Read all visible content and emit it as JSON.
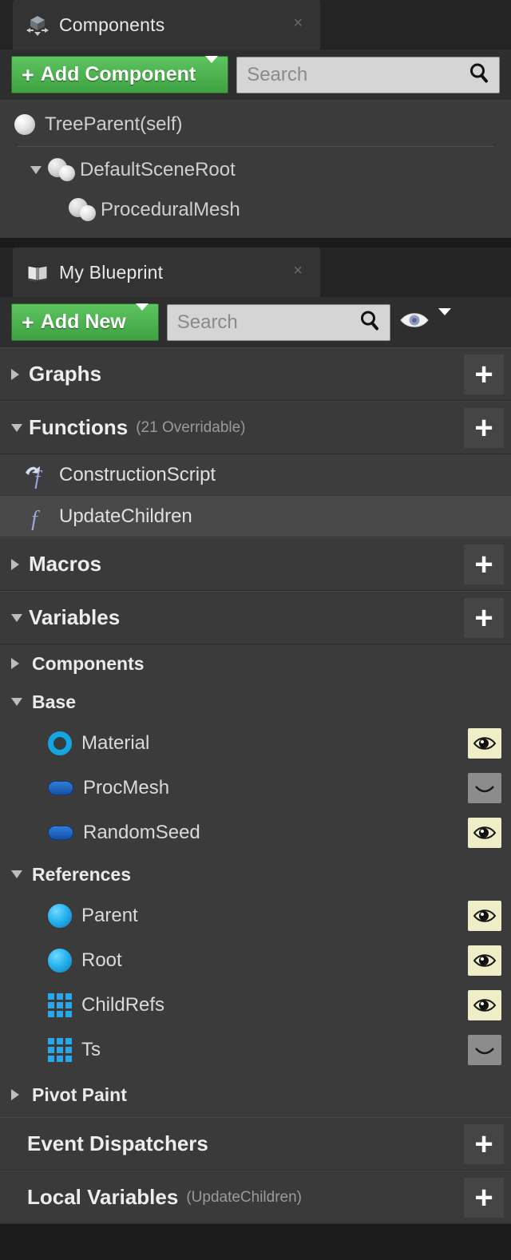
{
  "components_panel": {
    "tab": {
      "label": "Components",
      "icon": "components-cube-icon",
      "close": "×"
    },
    "toolbar": {
      "add_label": "Add Component",
      "add_plus": "+",
      "search_placeholder": "Search"
    },
    "tree": [
      {
        "label": "TreeParent(self)",
        "icon": "sphere-icon",
        "indent": 0,
        "expander": "none"
      },
      {
        "label": "DefaultSceneRoot",
        "icon": "scene-root-icon",
        "indent": 1,
        "expander": "expanded"
      },
      {
        "label": "ProceduralMesh",
        "icon": "mesh-icon",
        "indent": 2,
        "expander": "none"
      }
    ]
  },
  "my_blueprint_panel": {
    "tab": {
      "label": "My Blueprint",
      "icon": "book-icon",
      "close": "×"
    },
    "toolbar": {
      "add_label": "Add New",
      "add_plus": "+",
      "search_placeholder": "Search",
      "eye_icon": "eye-icon",
      "eye_caret": "chevron-down-icon"
    },
    "sections": {
      "graphs": {
        "title": "Graphs",
        "expander": "collapsed",
        "add": "+"
      },
      "functions": {
        "title": "Functions",
        "subtitle": "(21 Overridable)",
        "expander": "expanded",
        "add": "+"
      },
      "macros": {
        "title": "Macros",
        "expander": "collapsed",
        "add": "+"
      },
      "variables": {
        "title": "Variables",
        "expander": "expanded",
        "add": "+"
      },
      "event_dispatchers": {
        "title": "Event Dispatchers",
        "add": "+"
      },
      "local_variables": {
        "title": "Local Variables",
        "subtitle": "(UpdateChildren)",
        "add": "+"
      }
    },
    "functions": [
      {
        "label": "ConstructionScript",
        "icon": "function-override-icon",
        "selected": false
      },
      {
        "label": "UpdateChildren",
        "icon": "function-icon",
        "selected": true
      }
    ],
    "variable_categories": [
      {
        "label": "Components",
        "expander": "collapsed",
        "items": []
      },
      {
        "label": "Base",
        "expander": "expanded",
        "items": [
          {
            "label": "Material",
            "icon": "object-ring-icon",
            "visibility": "visible"
          },
          {
            "label": "ProcMesh",
            "icon": "object-pill-icon",
            "visibility": "hidden"
          },
          {
            "label": "RandomSeed",
            "icon": "object-pill-icon",
            "visibility": "visible"
          }
        ]
      },
      {
        "label": "References",
        "expander": "expanded",
        "items": [
          {
            "label": "Parent",
            "icon": "object-sphere-icon",
            "visibility": "visible"
          },
          {
            "label": "Root",
            "icon": "object-sphere-icon",
            "visibility": "visible"
          },
          {
            "label": "ChildRefs",
            "icon": "array-icon",
            "visibility": "visible"
          },
          {
            "label": "Ts",
            "icon": "array-icon",
            "visibility": "hidden"
          }
        ]
      },
      {
        "label": "Pivot Paint",
        "expander": "collapsed",
        "items": []
      }
    ]
  },
  "colors": {
    "accent_green": "#4cb34f",
    "panel_bg": "#3b3b3b",
    "tab_bg": "#333333",
    "window_bg": "#242424",
    "search_bg": "#d5d5d5",
    "type_blue": "#28a8ea",
    "type_ring": "#14a6e0",
    "eye_on_bg": "#efeec8",
    "eye_off_bg": "#8c8c8c"
  }
}
